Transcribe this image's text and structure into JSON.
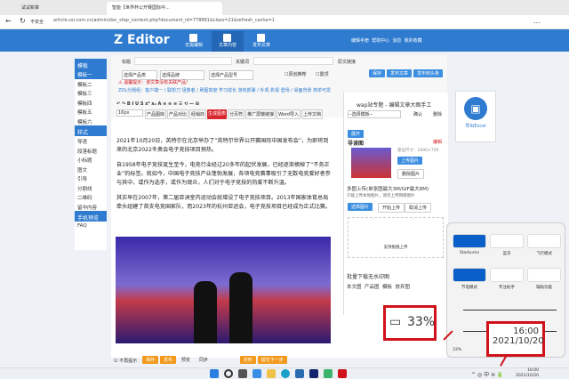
{
  "browser": {
    "tabs": [
      "试试新章",
      "智能【世界杯公开赛国际中…"
    ],
    "security": "不安全",
    "url": "article.ssl.com.cn/admin/doc_step_content.php?document_id=778881&class=21&refresh_cache=1"
  },
  "header": {
    "logo": "Z Editor",
    "nav": [
      "无需编辑",
      "文章内容",
      "发布文章"
    ],
    "links": [
      "编辑手册",
      "帮助中心",
      "消息",
      "我的收藏"
    ]
  },
  "sidebar": {
    "template_header": "模板",
    "templates": [
      "模板一",
      "模板二",
      "模板三",
      "模板四",
      "模板五",
      "模板六"
    ],
    "style_header": "样式",
    "styles": [
      "导语",
      "段落标题",
      "小标题",
      "图文",
      "引导",
      "分割线",
      "二维码",
      "留中内容"
    ],
    "preview": "手机预览",
    "faq": "FAQ"
  },
  "editor": {
    "title_label": "标题",
    "keyword_label": "关键词",
    "original_label": "原文链接",
    "selects": [
      "选择产品类",
      "选择品牌",
      "选择产品型号"
    ],
    "checkboxes": [
      "原创推荐",
      "置顶"
    ],
    "actions": [
      "保存",
      "发布文章",
      "发布到头条"
    ],
    "warning": "温馨提示：该文章没有关联产品!",
    "breadcrumb": "ZOL分题组：客户端一 / 联想刀 拯救者 / 刷图高度 学习成长 游戏部署 / 外观 影视 登场 / 桌面背景 简单可爱",
    "font_size": "16px",
    "tool_buttons": [
      "产品图库",
      "产品对比",
      "经销商",
      "生成图表",
      "分页符",
      "推广屏蔽链接",
      "Word导入",
      "上传文档"
    ],
    "paragraphs": [
      "2021年10月20日，英特尔在北京举办了“英特尔世界公开赛国际中国发布会”，为即将到来的北京2022冬奥会电子竞技项目预热。",
      "自1958年电子竞技诞生至今，电竞行业经过20多年的起伏发展，已经逐渐摘掉了“不务正业”的标签。就如今，中国电子竞技产业蓬勃发展，各项电竞赛事吸引了无数电竞爱好者参与其中，或作为选手，或作为观众，人们对于电子竞技的热爱不断升温。",
      "其实早在2007年，第二届亚洲室内运动会就增设了电子竞技项目。2013年国家体育总局牵头组建了首支电竞国家队，而2023年的杭州亚运会，电子竞技项目已经成为正式比赛。"
    ],
    "bottom_check": "不再提示",
    "bottom_buttons": [
      "保存",
      "发布",
      "预览",
      "同步",
      "定时",
      "提交下一步"
    ]
  },
  "right_panel": {
    "title": "wap站专题 - 编辑文章大图手工",
    "select": "--选择模板--",
    "confirm": "确认",
    "cancel": "删除",
    "unfold": "展开",
    "lead_image": "导读图",
    "edit": "编辑",
    "size_hint": "建议尺寸：1000×750",
    "upload": "上传图片",
    "delete_image": "删除图片",
    "multi_upload": "多图上传(单张图最大3M/GIF最大8M)",
    "multi_hint": "只能上传本地图片，请勿上传网络图片",
    "upload_buttons": [
      "选择图片",
      "开始上传",
      "取消上传"
    ],
    "drop_hint": "支持拖拽上传",
    "batch": "批量下载无水印图",
    "img_tabs": [
      "本文图",
      "产品图",
      "模板",
      "放弃图"
    ]
  },
  "float_widget": {
    "label": "导出Excel"
  },
  "quick_settings": {
    "tiles": [
      "Starbucks",
      "蓝牙",
      "飞行模式",
      "节电模式",
      "专注助手",
      "辅助功能"
    ],
    "battery_small": "33%",
    "volume_pct": 40,
    "brightness_pct": 10
  },
  "annotations": {
    "battery": "33%",
    "time": "16:00",
    "date": "2021/10/20"
  },
  "taskbar": {
    "time": "16:00",
    "date": "2021/10/20"
  },
  "colors": {
    "brand": "#2e7bd0",
    "accent": "#f39a1e",
    "annotation": "#d0121b"
  }
}
